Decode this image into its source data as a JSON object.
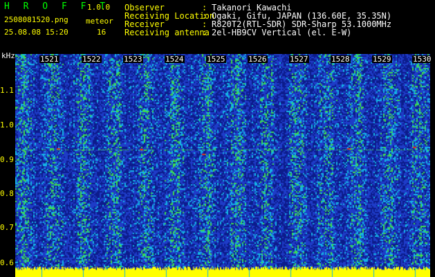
{
  "header": {
    "app_title": "H R O F F T",
    "version": "1.0.0",
    "filename": "2508081520.png",
    "meteor_label": "meteor",
    "datetime": "25.08.08 15:20",
    "meteor_count": "16"
  },
  "info": [
    {
      "label": "Observer",
      "sep": ":",
      "value": "Takanori Kawachi"
    },
    {
      "label": "Receiving Location",
      "sep": ":",
      "value": "Ogaki, Gifu, JAPAN (136.60E, 35.35N)"
    },
    {
      "label": "Receiver",
      "sep": ":",
      "value": "R820T2(RTL-SDR) SDR-Sharp 53.1000MHz"
    },
    {
      "label": "Receiving antenna",
      "sep": ":",
      "value": "2el-HB9CV Vertical (el. E-W)"
    }
  ],
  "axis": {
    "y_unit": "kHz",
    "y_ticks": [
      "1.1",
      "1.0",
      "0.9",
      "0.8",
      "0.7",
      "0.6"
    ],
    "x_ticks": [
      "1521",
      "1522",
      "1523",
      "1524",
      "1525",
      "1526",
      "1527",
      "1528",
      "1529",
      "1530"
    ]
  },
  "colors": {
    "background": "#000000",
    "label_yellow": "#ffff00",
    "title_green": "#00ff00",
    "value_white": "#ffffff",
    "noise_blue": "#1e3cc8",
    "noise_cyan": "#14b4e6",
    "noise_green": "#3cdc50",
    "floor_yellow": "#ffff00",
    "echo_red": "#e03020"
  }
}
